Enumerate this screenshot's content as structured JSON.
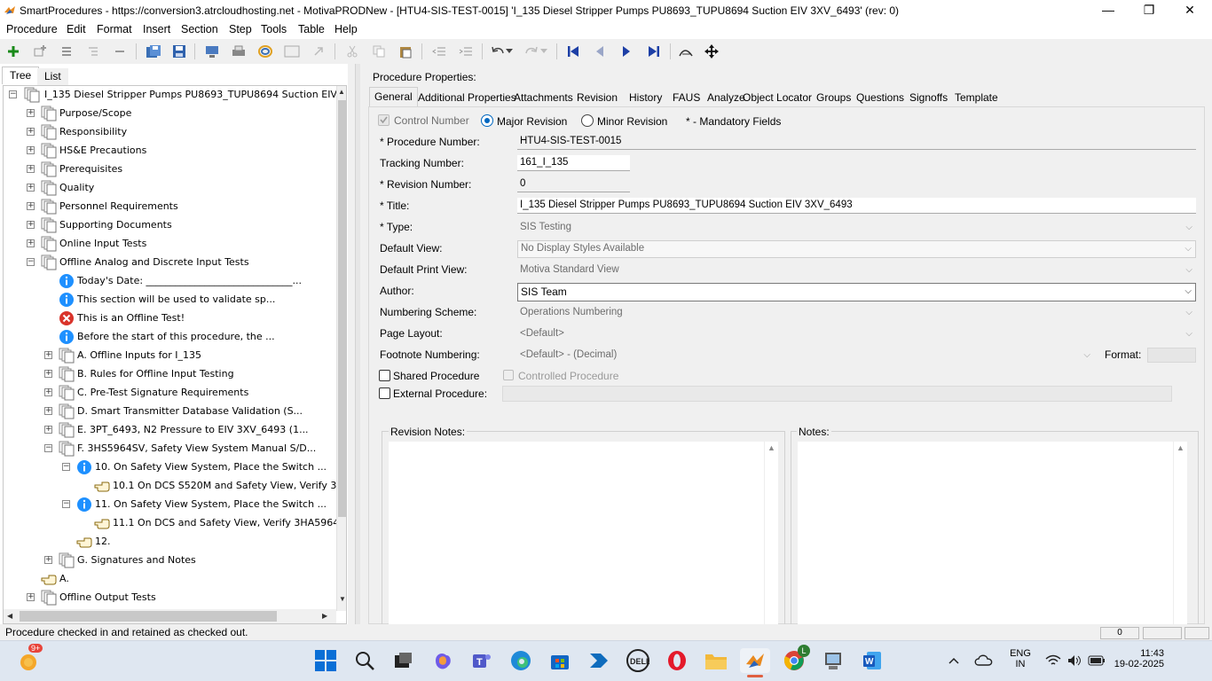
{
  "window": {
    "title": "SmartProcedures - https://conversion3.atrcloudhosting.net - MotivaPRODNew - [HTU4-SIS-TEST-0015] 'I_135 Diesel Stripper Pumps PU8693_TUPU8694 Suction EIV 3XV_6493' (rev: 0)",
    "minimize": "—",
    "restore": "❐",
    "close": "✕"
  },
  "menu": [
    "Procedure",
    "Edit",
    "Format",
    "Insert",
    "Section",
    "Step",
    "Tools",
    "Table",
    "Help"
  ],
  "toolbar": {
    "icons": [
      "add-icon",
      "add-child-icon",
      "list-icon",
      "indent-list-icon",
      "remove-icon",
      "save-all-icon",
      "save-icon",
      "export-icon",
      "print-icon",
      "refresh-icon",
      "window-icon",
      "redo-arrow-icon",
      "cut-icon",
      "copy-icon",
      "paste-icon",
      "outdent-icon",
      "indent-icon",
      "undo-icon",
      "redo-icon",
      "first-icon",
      "previous-icon",
      "next-icon",
      "last-icon",
      "find-icon",
      "move-icon"
    ]
  },
  "left_tabs": {
    "tree": "Tree",
    "list": "List"
  },
  "tree": {
    "root": "I_135  Diesel  Stripper  Pumps  PU8693_TUPU8694  Suction  EIV  3...",
    "items": [
      {
        "label": "Purpose/Scope"
      },
      {
        "label": "Responsibility"
      },
      {
        "label": "HS&E Precautions"
      },
      {
        "label": "Prerequisites"
      },
      {
        "label": "Quality"
      },
      {
        "label": "Personnel Requirements"
      },
      {
        "label": "Supporting Documents"
      },
      {
        "label": "Online Input Tests"
      },
      {
        "label": "Offline Analog and Discrete Input Tests"
      },
      {
        "label": "Today's Date: ______________________________..."
      },
      {
        "label": "This section will be used to validate sp..."
      },
      {
        "label": "This is an Offline Test!"
      },
      {
        "label": "Before the start of this procedure, the ..."
      },
      {
        "label": "A. Offline Inputs for I_135"
      },
      {
        "label": "B. Rules for Offline Input Testing"
      },
      {
        "label": "C. Pre-Test Signature Requirements"
      },
      {
        "label": "D. Smart Transmitter Database Validation (S..."
      },
      {
        "label": "E. 3PT_6493, N2 Pressure to EIV 3XV_6493 (1..."
      },
      {
        "label": "F. 3HS5964SV, Safety View System Manual S/D..."
      },
      {
        "label": "10. On Safety View System, Place the Switch ..."
      },
      {
        "label": "10.1 On DCS S520M and Safety View, Verify 3..."
      },
      {
        "label": "11. On Safety View System, Place the Switch ..."
      },
      {
        "label": "11.1 On DCS and Safety View, Verify 3HA5964..."
      },
      {
        "label": "12."
      },
      {
        "label": "G. Signatures and Notes"
      },
      {
        "label": "A."
      },
      {
        "label": "Offline Output Tests"
      }
    ]
  },
  "props": {
    "heading": "Procedure Properties:",
    "tabs": [
      "General",
      "Additional Properties",
      "Attachments",
      "Revision",
      "History",
      "FAUS",
      "Analyze",
      "Object Locator",
      "Groups",
      "Questions",
      "Signoffs",
      "Template"
    ],
    "control_number": "Control Number",
    "major_revision": "Major Revision",
    "minor_revision": "Minor Revision",
    "mandatory": "* - Mandatory Fields",
    "labels": {
      "procedure_number": "* Procedure Number:",
      "tracking_number": "Tracking Number:",
      "revision_number": "* Revision Number:",
      "title": "* Title:",
      "type": "* Type:",
      "default_view": "Default View:",
      "default_print_view": "Default Print View:",
      "author": "Author:",
      "numbering_scheme": "Numbering Scheme:",
      "page_layout": "Page Layout:",
      "footnote_numbering": "Footnote Numbering:",
      "format": "Format:",
      "shared_procedure": "Shared Procedure",
      "controlled_procedure": "Controlled Procedure",
      "external_procedure": "External Procedure:",
      "revision_notes": "Revision Notes:",
      "notes": "Notes:"
    },
    "values": {
      "procedure_number": "HTU4-SIS-TEST-0015",
      "tracking_number": "161_I_135",
      "revision_number": "0",
      "title": "I_135 Diesel Stripper Pumps PU8693_TUPU8694 Suction EIV 3XV_6493",
      "type": "SIS Testing",
      "default_view": "No Display Styles Available",
      "default_print_view": "Motiva Standard View",
      "author": "SIS Team",
      "numbering_scheme": "Operations Numbering",
      "page_layout": "<Default>",
      "footnote_numbering": "<Default> - (Decimal)"
    }
  },
  "status": {
    "text": "Procedure checked in and retained as checked out.",
    "panel1": "0"
  },
  "taskbar": {
    "weather_badge": "9+",
    "lang_line1": "ENG",
    "lang_line2": "IN",
    "time": "11:43",
    "date": "19-02-2025",
    "chrome_badge": "L"
  },
  "colors": {
    "accent": "#0078d4",
    "info_icon": "#1e90ff",
    "error_icon": "#d9342b",
    "nav_arrow": "#1d3fa6"
  }
}
